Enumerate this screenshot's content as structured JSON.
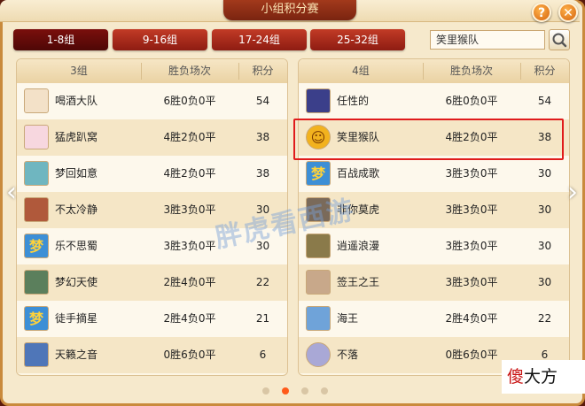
{
  "title": "小组积分赛",
  "tabs": [
    {
      "label": "1-8组",
      "active": true
    },
    {
      "label": "9-16组",
      "active": false
    },
    {
      "label": "17-24组",
      "active": false
    },
    {
      "label": "25-32组",
      "active": false
    }
  ],
  "search": {
    "value": "笑里猴队"
  },
  "headers": {
    "record": "胜负场次",
    "points": "积分"
  },
  "left_group": {
    "name": "3组",
    "rows": [
      {
        "name": "喝酒大队",
        "record": "6胜0负0平",
        "points": "54",
        "icon": "drinker-avatar",
        "color": "#f3e1c8"
      },
      {
        "name": "猛虎趴窝",
        "record": "4胜2负0平",
        "points": "38",
        "icon": "girl-avatar",
        "color": "#f7d7df"
      },
      {
        "name": "梦回如意",
        "record": "4胜2负0平",
        "points": "38",
        "icon": "pixel-avatar",
        "color": "#6fb6c0"
      },
      {
        "name": "不太冷静",
        "record": "3胜3负0平",
        "points": "30",
        "icon": "warrior-avatar",
        "color": "#b0593b"
      },
      {
        "name": "乐不思蜀",
        "record": "3胜3负0平",
        "points": "30",
        "icon": "meng-logo-avatar",
        "color": "#3d8fd6"
      },
      {
        "name": "梦幻天使",
        "record": "2胜4负0平",
        "points": "22",
        "icon": "scene-avatar",
        "color": "#5b7f5c"
      },
      {
        "name": "徒手摘星",
        "record": "2胜4负0平",
        "points": "21",
        "icon": "meng-logo-avatar",
        "color": "#3d8fd6"
      },
      {
        "name": "天籁之音",
        "record": "0胜6负0平",
        "points": "6",
        "icon": "light-avatar",
        "color": "#4f76b8"
      }
    ]
  },
  "right_group": {
    "name": "4组",
    "rows": [
      {
        "name": "任性的",
        "record": "6胜0负0平",
        "points": "54",
        "icon": "dark-avatar",
        "color": "#3b3f8a"
      },
      {
        "name": "笑里猴队",
        "record": "4胜2负0平",
        "points": "38",
        "icon": "monkey-avatar",
        "color": "#f2b21e"
      },
      {
        "name": "百战成歌",
        "record": "3胜3负0平",
        "points": "30",
        "icon": "meng-logo-avatar",
        "color": "#3d8fd6"
      },
      {
        "name": "非你莫虎",
        "record": "3胜3负0平",
        "points": "30",
        "icon": "masked-avatar",
        "color": "#7a6a5a"
      },
      {
        "name": "逍遥浪漫",
        "record": "3胜3负0平",
        "points": "30",
        "icon": "horseman-avatar",
        "color": "#8a7a4a"
      },
      {
        "name": "签王之王",
        "record": "3胜3负0平",
        "points": "30",
        "icon": "sage-avatar",
        "color": "#c8a88a"
      },
      {
        "name": "海王",
        "record": "2胜4负0平",
        "points": "22",
        "icon": "bluehair-avatar",
        "color": "#6fa3d9"
      },
      {
        "name": "不落",
        "record": "0胜6负0平",
        "points": "6",
        "icon": "circle-avatar",
        "color": "#a9a8d6"
      }
    ]
  },
  "pagination": {
    "pages": 4,
    "current": 2
  },
  "watermark": "胖虎看西游",
  "corner_logo": {
    "first": "傻",
    "rest": "大方"
  },
  "colors": {
    "accent": "#8e1c12",
    "highlight": "#e01b1b",
    "panel": "#fdf6e4"
  }
}
